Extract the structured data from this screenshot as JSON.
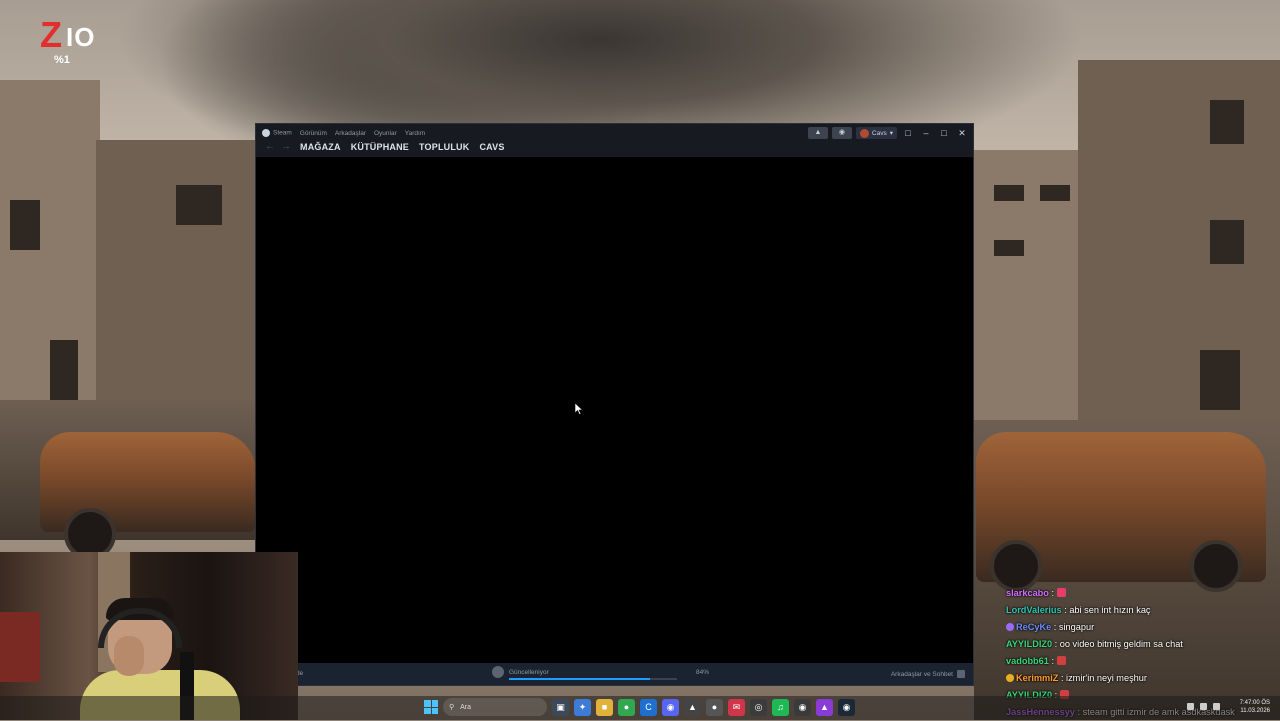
{
  "overlay_logo": {
    "letter_z": "Z",
    "letters_io": "IO",
    "percent": "%1"
  },
  "steam": {
    "menu": [
      "Steam",
      "Görünüm",
      "Arkadaşlar",
      "Oyunlar",
      "Yardım"
    ],
    "nav": [
      "MAĞAZA",
      "KÜTÜPHANE",
      "TOPLULUK",
      "CAVS"
    ],
    "account_name": "Cavs",
    "status": {
      "update_label": "Güncelleniyor",
      "progress_percent": 84,
      "progress_text": "84%",
      "friends_chat": "Arkadaşlar ve Sohbet",
      "left_fragment": "de"
    }
  },
  "chat": [
    {
      "user": "slarkcabo",
      "text": " : ",
      "color": "#d070ff",
      "emote": "#e83c6a"
    },
    {
      "user": "LordValerius",
      "text": " : abi sen int hızın kaç",
      "color": "#2ec4b0"
    },
    {
      "user": "ReCyKe",
      "text": " : singapur",
      "color": "#6a8cff",
      "badge": "#9a6aff"
    },
    {
      "user": "AYYILDIZ0",
      "text": " : oo video bitmiş geldim sa chat",
      "color": "#38d67a"
    },
    {
      "user": "vadobb61",
      "text": " : ",
      "color": "#38d67a",
      "emote": "#d04040"
    },
    {
      "user": "KerimmiZ",
      "text": " : izmir'in neyi meşhur",
      "color": "#ff9a2e",
      "badge": "#e8b020"
    },
    {
      "user": "AYYILDIZ0",
      "text": " : ",
      "color": "#38d67a",
      "emote": "#d04040"
    },
    {
      "user": "JassHennessyy",
      "text": " : steam gitti izmir de amk asdkaskdask",
      "color": "#c86aff"
    }
  ],
  "taskbar": {
    "search_placeholder": "Ara",
    "time": "7:47:00 ÖS",
    "date": "11.03.2026"
  }
}
